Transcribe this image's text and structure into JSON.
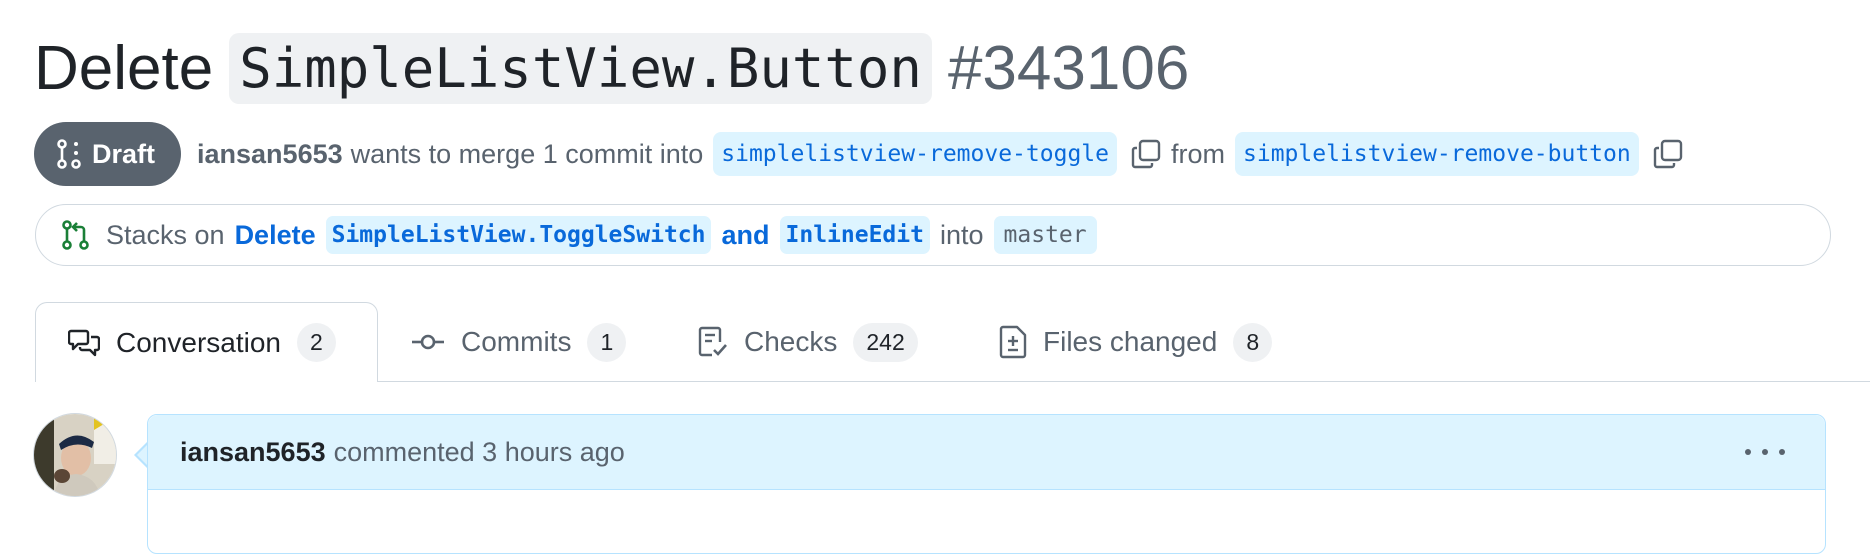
{
  "pr": {
    "title_prefix": "Delete",
    "title_code": "SimpleListView.Button",
    "number": "#343106"
  },
  "meta": {
    "status": "Draft",
    "author": "iansan5653",
    "merge_text": "wants to merge 1 commit into",
    "base_branch": "simplelistview-remove-toggle",
    "from_text": "from",
    "head_branch": "simplelistview-remove-button"
  },
  "stack": {
    "prefix": "Stacks on",
    "link_word1": "Delete",
    "link_code1": "SimpleListView.ToggleSwitch",
    "link_word2": "and",
    "link_code2": "InlineEdit",
    "into": "into",
    "target": "master"
  },
  "tabs": [
    {
      "label": "Conversation",
      "count": "2",
      "icon": "comment-discussion-icon",
      "selected": true
    },
    {
      "label": "Commits",
      "count": "1",
      "icon": "git-commit-icon",
      "selected": false
    },
    {
      "label": "Checks",
      "count": "242",
      "icon": "checklist-icon",
      "selected": false
    },
    {
      "label": "Files changed",
      "count": "8",
      "icon": "file-diff-icon",
      "selected": false
    }
  ],
  "comment": {
    "author": "iansan5653",
    "meta": "commented 3 hours ago"
  },
  "colors": {
    "accent": "#0969da",
    "accent_bg": "#ddf4ff",
    "muted": "#59636e",
    "border": "#d1d9e0"
  }
}
